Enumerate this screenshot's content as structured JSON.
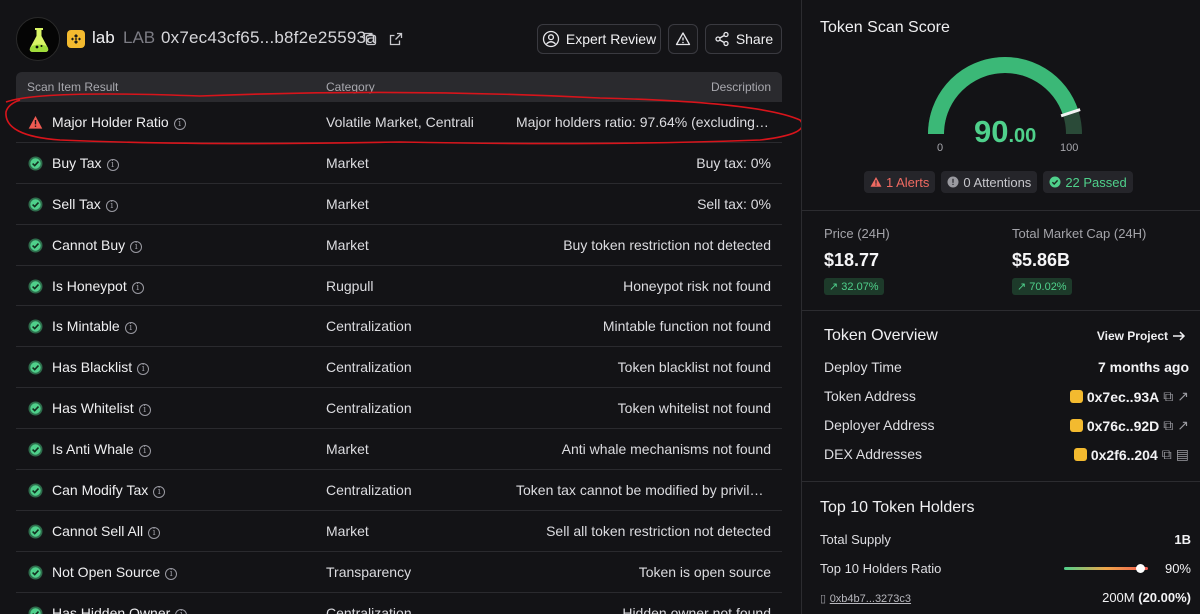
{
  "token": {
    "name": "lab",
    "symbol": "LAB",
    "address": "0x7ec43cf65...b8f2e25593a"
  },
  "header": {
    "expert_review_label": "Expert Review",
    "share_label": "Share"
  },
  "table": {
    "columns": {
      "item": "Scan Item Result",
      "category": "Category",
      "description": "Description"
    },
    "rows": [
      {
        "status": "alert",
        "name": "Major Holder Ratio",
        "category": "Volatile Market, Centraliz",
        "description": "Major holders ratio: 97.64% (excluding h..."
      },
      {
        "status": "pass",
        "name": "Buy Tax",
        "category": "Market",
        "description": "Buy tax: 0%"
      },
      {
        "status": "pass",
        "name": "Sell Tax",
        "category": "Market",
        "description": "Sell tax: 0%"
      },
      {
        "status": "pass",
        "name": "Cannot Buy",
        "category": "Market",
        "description": "Buy token restriction not detected"
      },
      {
        "status": "pass",
        "name": "Is Honeypot",
        "category": "Rugpull",
        "description": "Honeypot risk not found"
      },
      {
        "status": "pass",
        "name": "Is Mintable",
        "category": "Centralization",
        "description": "Mintable function not found"
      },
      {
        "status": "pass",
        "name": "Has Blacklist",
        "category": "Centralization",
        "description": "Token blacklist not found"
      },
      {
        "status": "pass",
        "name": "Has Whitelist",
        "category": "Centralization",
        "description": "Token whitelist not found"
      },
      {
        "status": "pass",
        "name": "Is Anti Whale",
        "category": "Market",
        "description": "Anti whale mechanisms not found"
      },
      {
        "status": "pass",
        "name": "Can Modify Tax",
        "category": "Centralization",
        "description": "Token tax cannot be modified by privileg..."
      },
      {
        "status": "pass",
        "name": "Cannot Sell All",
        "category": "Market",
        "description": "Sell all token restriction not detected"
      },
      {
        "status": "pass",
        "name": "Not Open Source",
        "category": "Transparency",
        "description": "Token is open source"
      },
      {
        "status": "pass",
        "name": "Has Hidden Owner",
        "category": "Centralization",
        "description": "Hidden owner not found"
      }
    ]
  },
  "scan_score": {
    "title": "Token Scan Score",
    "score_int": "90",
    "score_dec": ".00",
    "score_value": 90,
    "gauge_min": "0",
    "gauge_max": "100",
    "alerts": "1 Alerts",
    "attentions": "0 Attentions",
    "passed": "22 Passed"
  },
  "market": {
    "price_label": "Price (24H)",
    "price_value": "$18.77",
    "price_change": "32.07%",
    "mcap_label": "Total Market Cap (24H)",
    "mcap_value": "$5.86B",
    "mcap_change": "70.02%"
  },
  "overview": {
    "title": "Token Overview",
    "view_project": "View Project",
    "deploy_time_label": "Deploy Time",
    "deploy_time_value": "7 months ago",
    "token_address_label": "Token Address",
    "token_address_value": "0x7ec..93A",
    "deployer_address_label": "Deployer Address",
    "deployer_address_value": "0x76c..92D",
    "dex_addresses_label": "DEX Addresses",
    "dex_addresses_value": "0x2f6..204"
  },
  "holders": {
    "title": "Top 10 Token Holders",
    "total_supply_label": "Total Supply",
    "total_supply_value": "1B",
    "ratio_label": "Top 10 Holders Ratio",
    "ratio_value": "90%",
    "ratio_fraction": 0.9,
    "first_holder_address": "0xb4b7...3273c3",
    "first_holder_amount": "200M",
    "first_holder_pct": "(20.00%)"
  },
  "colors": {
    "pass_green": "#4fd08b",
    "alert_red": "#ef5a52",
    "annotation_red": "#d8141b",
    "background": "#131316"
  }
}
